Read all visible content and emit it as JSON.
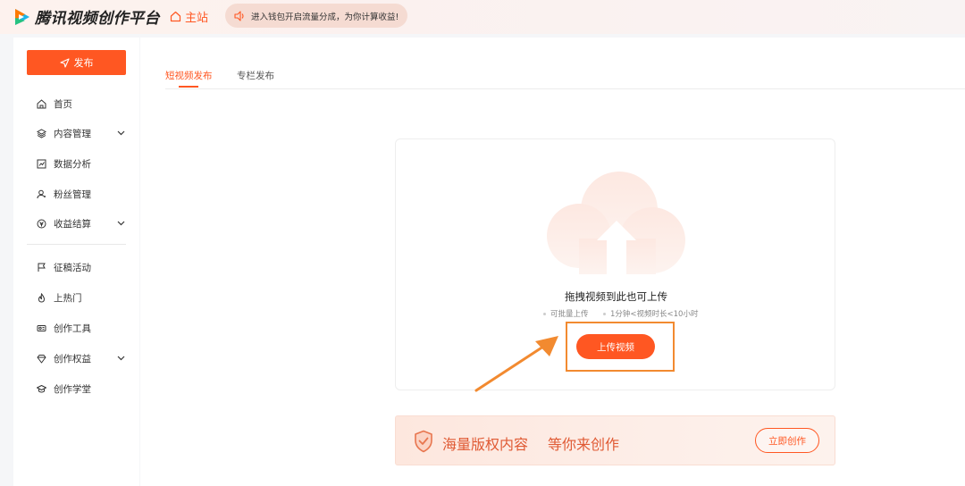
{
  "topbar": {
    "logo_text": "腾讯视频创作平台",
    "home_label": "主站",
    "notice_text": "进入钱包开启流量分成，为你计算收益!"
  },
  "sidebar": {
    "publish_label": "发布",
    "items": [
      {
        "label": "首页",
        "icon": "home-icon"
      },
      {
        "label": "内容管理",
        "icon": "layers-icon",
        "expandable": true
      },
      {
        "label": "数据分析",
        "icon": "chart-icon"
      },
      {
        "label": "粉丝管理",
        "icon": "user-icon"
      },
      {
        "label": "收益结算",
        "icon": "income-icon",
        "expandable": true
      },
      {
        "label": "征稿活动",
        "icon": "flag-icon"
      },
      {
        "label": "上热门",
        "icon": "flame-icon"
      },
      {
        "label": "创作工具",
        "icon": "tools-icon"
      },
      {
        "label": "创作权益",
        "icon": "diamond-icon",
        "expandable": true
      },
      {
        "label": "创作学堂",
        "icon": "graduation-icon"
      }
    ]
  },
  "main": {
    "tabs": [
      {
        "label": "短视频发布",
        "active": true
      },
      {
        "label": "专栏发布",
        "active": false
      }
    ],
    "upload": {
      "title": "拖拽视频到此也可上传",
      "hint_batch": "可批量上传",
      "hint_duration": "1分钟<视频时长<10小时",
      "button_label": "上传视频"
    },
    "banner": {
      "text_primary": "海量版权内容",
      "text_secondary": "等你来创作",
      "button_label": "立即创作"
    }
  },
  "colors": {
    "accent": "#ff5722",
    "annotation": "#f28a30"
  }
}
